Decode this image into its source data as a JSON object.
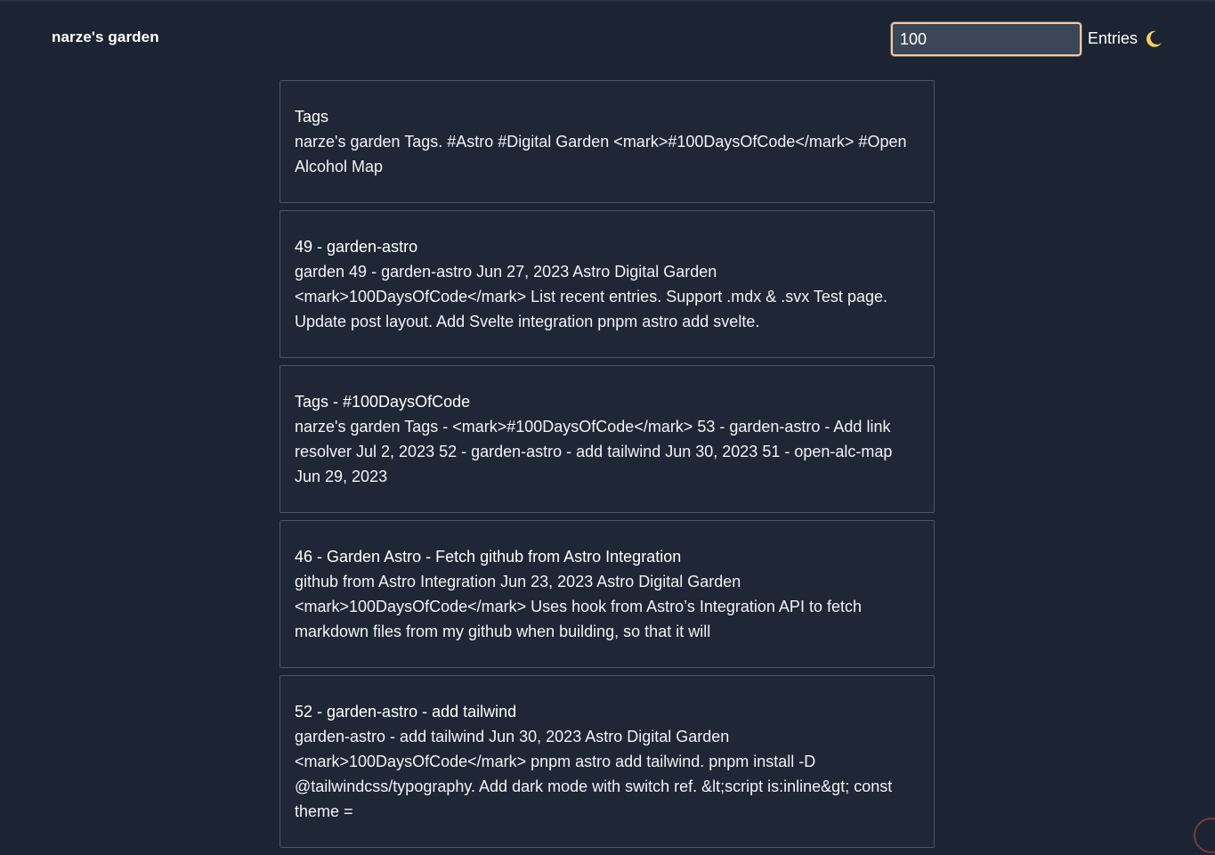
{
  "header": {
    "site_title": "narze's garden",
    "search_value": "100",
    "entries_label": "Entries",
    "theme_icon": "moon-icon"
  },
  "results": [
    {
      "title": "Tags",
      "excerpt": "narze's garden Tags. #Astro #Digital Garden <mark>#100DaysOfCode</mark> #Open Alcohol Map"
    },
    {
      "title": "49 - garden-astro",
      "excerpt": "garden 49 - garden-astro Jun 27, 2023 Astro Digital Garden <mark>100DaysOfCode</mark> List recent entries. Support .mdx & .svx Test page. Update post layout. Add Svelte integration pnpm astro add svelte."
    },
    {
      "title": "Tags - #100DaysOfCode",
      "excerpt": "narze's garden Tags - <mark>#100DaysOfCode</mark> 53 - garden-astro - Add link resolver Jul 2, 2023 52 - garden-astro - add tailwind Jun 30, 2023 51 - open-alc-map Jun 29, 2023"
    },
    {
      "title": "46 - Garden Astro - Fetch github from Astro Integration",
      "excerpt": "github from Astro Integration Jun 23, 2023 Astro Digital Garden <mark>100DaysOfCode</mark> Uses hook from Astro’s Integration API to fetch markdown files from my github when building, so that it will"
    },
    {
      "title": "52 - garden-astro - add tailwind",
      "excerpt": "garden-astro - add tailwind Jun 30, 2023 Astro Digital Garden <mark>100DaysOfCode</mark> pnpm astro add tailwind. pnpm install -D @tailwindcss/typography. Add dark mode with switch ref. &lt;script is:inline&gt; const theme ="
    }
  ]
}
